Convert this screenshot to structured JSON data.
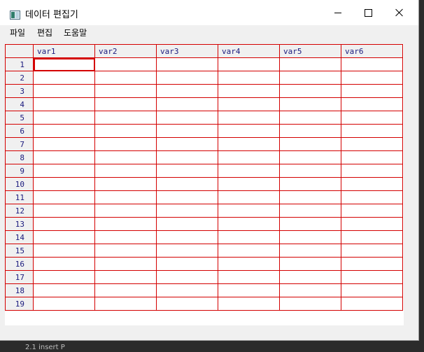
{
  "window": {
    "title": "데이터 편집기",
    "app_icon": "data-editor-icon",
    "controls": {
      "minimize_icon": "minimize-icon",
      "maximize_icon": "maximize-icon",
      "close_icon": "close-icon"
    }
  },
  "menubar": {
    "items": [
      {
        "label": "파일"
      },
      {
        "label": "편집"
      },
      {
        "label": "도움말"
      }
    ]
  },
  "grid": {
    "columns": [
      "var1",
      "var2",
      "var3",
      "var4",
      "var5",
      "var6"
    ],
    "rows": [
      "1",
      "2",
      "3",
      "4",
      "5",
      "6",
      "7",
      "8",
      "9",
      "10",
      "11",
      "12",
      "13",
      "14",
      "15",
      "16",
      "17",
      "18",
      "19"
    ],
    "active_cell": {
      "row": "1",
      "column": "var1"
    },
    "border_color": "#d40000",
    "header_text_color": "#1a1a7e"
  },
  "background_text": "2.1 insert P"
}
